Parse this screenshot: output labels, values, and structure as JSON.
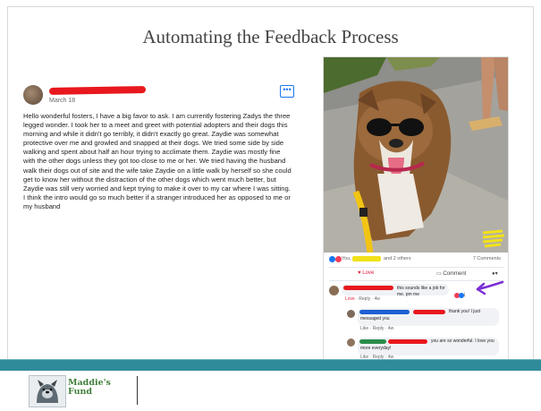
{
  "slide": {
    "title": "Automating the Feedback Process"
  },
  "post": {
    "date": "March 18",
    "more_label": "•••",
    "body": "Hello wonderful fosters, I have a big favor to ask. I am currently fostering Zadys the three legged wonder. I took her to a meet and greet with potential adopters and their dogs this morning and while it didn't go terribly, it didn't exactly go great. Zaydie was somewhat protective over me and growled and snapped at their dogs. We tried some side by side walking and spent about half an hour trying to acclimate them. Zaydie was mostly fine with the other dogs unless they got too close to me or her. We tried having the husband walk their dogs out of site and the wife take Zaydie on a little walk by herself so she could get to know her without the distraction of the other dogs which went much better, but Zaydie was still very worried and kept trying to make it over to my car where I was sitting. I think the intro would go so much better if a stranger introduced her as opposed to me or my husband"
  },
  "screenshot": {
    "reactions_you": "You,",
    "reactions_others": "and 2 others",
    "comment_count": "7 Comments",
    "love_label": "Love",
    "comment_label": "Comment",
    "share_label": "▾",
    "comments": [
      {
        "text": "this sounds like a job for me. pm me",
        "reaction_count": "1",
        "meta_love": "Love",
        "meta_rest": " · Reply · 4w"
      },
      {
        "text": "thank you! I just",
        "text2": "messaged you",
        "meta": "Like · Reply · 4w"
      },
      {
        "text": "you are so wonderful. I love you",
        "text2": "more everyday!",
        "meta": "Like · Reply · 4w"
      }
    ]
  },
  "footer": {
    "logo_line1": "Maddie's",
    "logo_line2": "Fund"
  },
  "colors": {
    "teal": "#2f8b9a",
    "redaction": "#e8181e",
    "facebook_blue": "#1877f2",
    "arrow": "#7b2fd6"
  }
}
